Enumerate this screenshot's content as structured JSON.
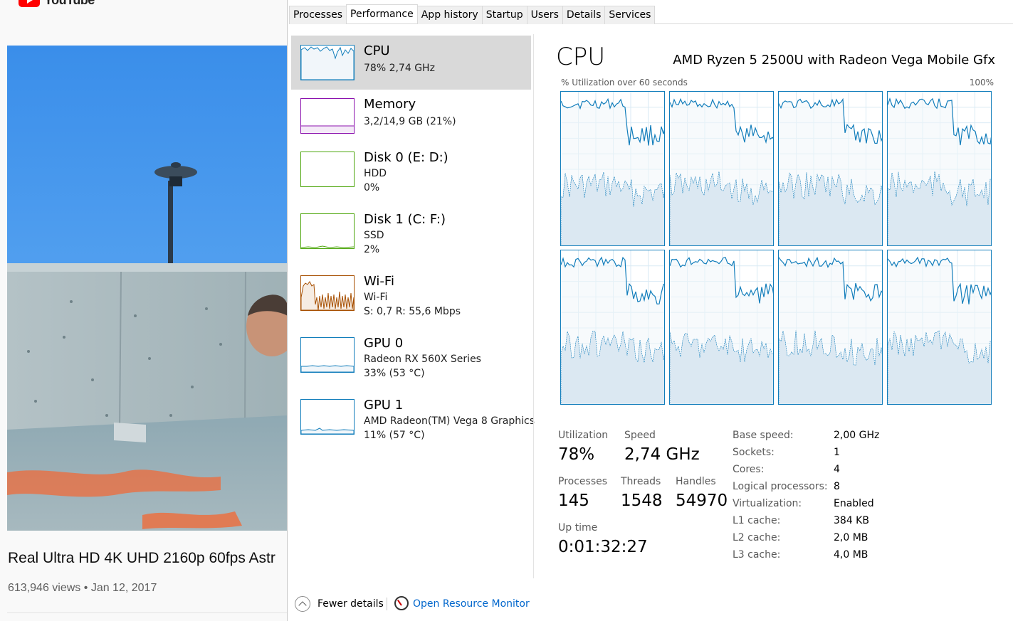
{
  "youtube": {
    "logo_text": "YouTube",
    "video_title": "Real Ultra HD 4K UHD 2160p 60fps Astr",
    "views": "613,946 views",
    "dot": "•",
    "date": "Jan 12, 2017"
  },
  "tabs": [
    {
      "label": "Processes"
    },
    {
      "label": "Performance"
    },
    {
      "label": "App history"
    },
    {
      "label": "Startup"
    },
    {
      "label": "Users"
    },
    {
      "label": "Details"
    },
    {
      "label": "Services"
    }
  ],
  "active_tab": "Performance",
  "resources": [
    {
      "name": "CPU",
      "line1": "78%  2,74 GHz",
      "line2": "",
      "color": "#117dbb"
    },
    {
      "name": "Memory",
      "line1": "3,2/14,9 GB (21%)",
      "line2": "",
      "color": "#8b12ae"
    },
    {
      "name": "Disk 0 (E: D:)",
      "line1": "HDD",
      "line2": "0%",
      "color": "#4da60c"
    },
    {
      "name": "Disk 1 (C: F:)",
      "line1": "SSD",
      "line2": "2%",
      "color": "#4da60c"
    },
    {
      "name": "Wi-Fi",
      "line1": "Wi-Fi",
      "line2": "S: 0,7  R: 55,6 Mbps",
      "color": "#a74f01"
    },
    {
      "name": "GPU 0",
      "line1": "Radeon RX 560X Series",
      "line2": "33%  (53 °C)",
      "color": "#117dbb"
    },
    {
      "name": "GPU 1",
      "line1": "AMD Radeon(TM) Vega 8 Graphics",
      "line2": "11%  (57 °C)",
      "color": "#117dbb"
    }
  ],
  "cpu_panel": {
    "title": "CPU",
    "model": "AMD Ryzen 5 2500U with Radeon Vega Mobile Gfx",
    "graph_label": "% Utilization over 60 seconds",
    "graph_max": "100%",
    "stats": {
      "utilization_label": "Utilization",
      "utilization": "78%",
      "speed_label": "Speed",
      "speed": "2,74 GHz",
      "processes_label": "Processes",
      "processes": "145",
      "threads_label": "Threads",
      "threads": "1548",
      "handles_label": "Handles",
      "handles": "54970",
      "uptime_label": "Up time",
      "uptime": "0:01:32:27"
    },
    "specs": [
      {
        "key": "Base speed:",
        "value": "2,00 GHz"
      },
      {
        "key": "Sockets:",
        "value": "1"
      },
      {
        "key": "Cores:",
        "value": "4"
      },
      {
        "key": "Logical processors:",
        "value": "8"
      },
      {
        "key": "Virtualization:",
        "value": "Enabled"
      },
      {
        "key": "L1 cache:",
        "value": "384 KB"
      },
      {
        "key": "L2 cache:",
        "value": "2,0 MB"
      },
      {
        "key": "L3 cache:",
        "value": "4,0 MB"
      }
    ]
  },
  "footer": {
    "fewer_details": "Fewer details",
    "open_resource_monitor": "Open Resource Monitor"
  },
  "colors": {
    "cpu_line": "#117dbb",
    "cpu_fill": "#f1f6fa",
    "grid": "#d9eaf4",
    "selected_bg": "#d9d9d9",
    "link": "#0066cc"
  }
}
